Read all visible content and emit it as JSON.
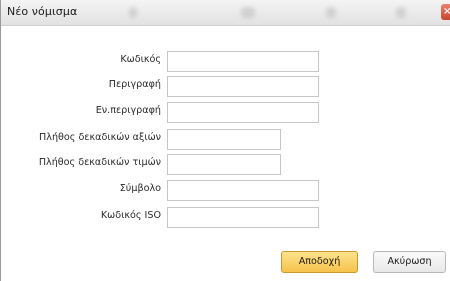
{
  "window": {
    "title": "Νέο νόμισμα",
    "close_glyph": "×"
  },
  "form": {
    "fields": [
      {
        "label": "Κωδικός",
        "value": ""
      },
      {
        "label": "Περιγραφή",
        "value": ""
      },
      {
        "label": "Εν.περιγραφή",
        "value": ""
      },
      {
        "label": "Πλήθος δεκαδικών αξιών",
        "value": ""
      },
      {
        "label": "Πλήθος δεκαδικών τιμών",
        "value": ""
      },
      {
        "label": "Σύμβολο",
        "value": ""
      },
      {
        "label": "Κωδικός ISO",
        "value": ""
      }
    ]
  },
  "buttons": {
    "ok_label": "Αποδοχή",
    "cancel_label": "Ακύρωση"
  },
  "colors": {
    "ok_button": "#f6c24b",
    "close_button": "#c6452d"
  }
}
